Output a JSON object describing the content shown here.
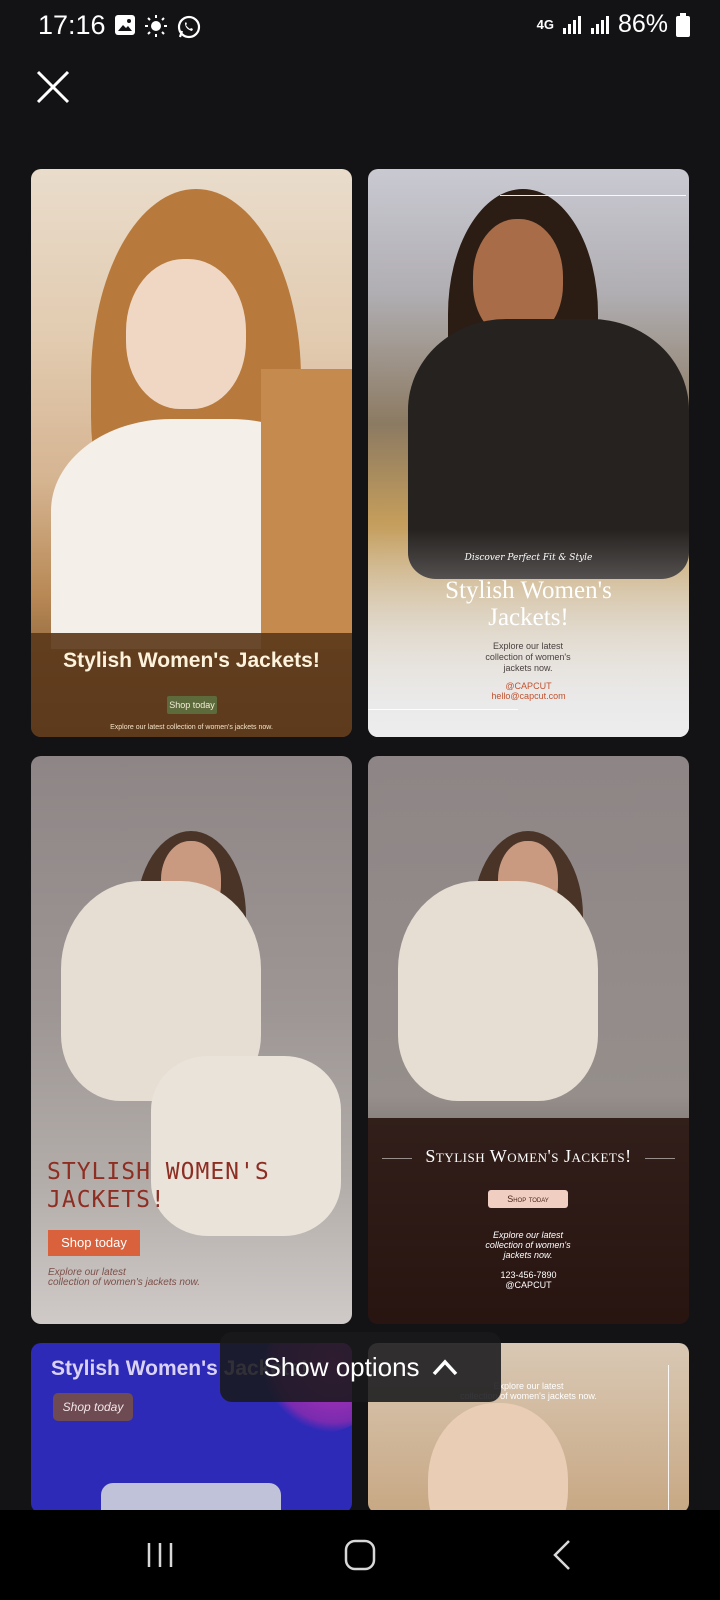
{
  "status_bar": {
    "time": "17:16",
    "network": "4G",
    "battery": "86%"
  },
  "cards": [
    {
      "title": "Stylish Women's Jackets!",
      "button": "Shop today",
      "subtitle": "Explore our latest collection of women's jackets now."
    },
    {
      "script": "Discover Perfect Fit & Style",
      "title_line1": "Stylish Women's",
      "title_line2": "Jackets!",
      "subtitle_line1": "Explore our latest",
      "subtitle_line2": "collection of women's",
      "subtitle_line3": "jackets now.",
      "handle": "@CAPCUT",
      "email": "hello@capcut.com"
    },
    {
      "title_line1": "STYLISH WOMEN'S",
      "title_line2": "JACKETS!",
      "button": "Shop today",
      "subtitle_line1": "Explore our latest",
      "subtitle_line2": "collection of women's jackets now."
    },
    {
      "title": "Stylish Women's Jackets!",
      "button": "Shop today",
      "subtitle_line1": "Explore our latest",
      "subtitle_line2": "collection of women's",
      "subtitle_line3": "jackets now.",
      "phone": "123-456-7890",
      "handle": "@CAPCUT"
    },
    {
      "title": "Stylish Women's Jackets!",
      "button": "Shop today"
    },
    {
      "subtitle_line1": "Explore our latest",
      "subtitle_line2": "collection of women's jackets now."
    }
  ],
  "show_options": {
    "label": "Show options"
  },
  "colors": {
    "background": "#131316",
    "card1_band": "#5c3a1b",
    "card3_title": "#8e2e23",
    "card3_button": "#d9623c",
    "card5_bg": "#2d2ab8"
  }
}
